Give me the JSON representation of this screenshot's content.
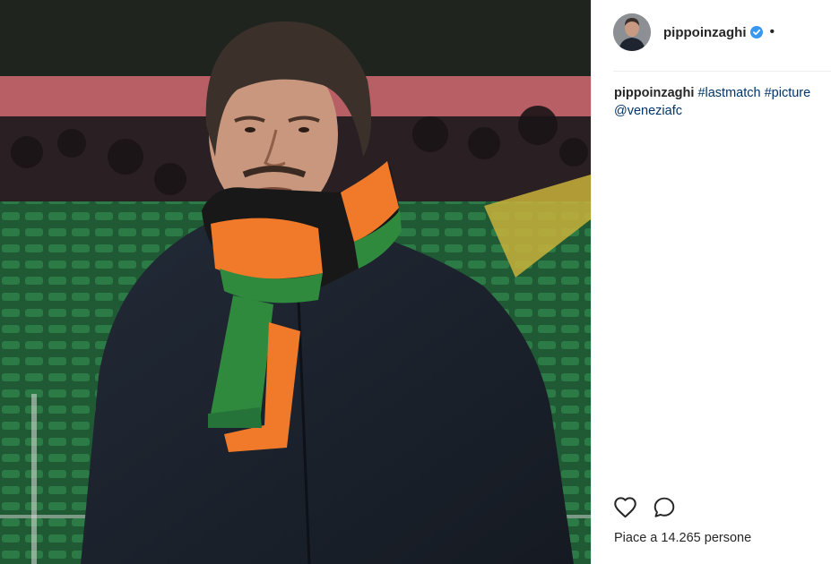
{
  "post": {
    "username": "pippoinzaghi",
    "verified": true,
    "separator": "•",
    "caption": {
      "username": "pippoinzaghi",
      "tags": [
        "#lastmatch",
        "#picture"
      ],
      "mention": "@veneziafc"
    },
    "likes_text": "Piace a 14.265 persone"
  },
  "icons": {
    "verified": "verified-badge-icon",
    "like": "heart-icon",
    "comment": "comment-bubble-icon"
  },
  "colors": {
    "verified_blue": "#3897f0",
    "link_blue": "#003569",
    "text": "#262626",
    "scarf_orange": "#f07a2a",
    "scarf_green": "#2f8a3e"
  }
}
